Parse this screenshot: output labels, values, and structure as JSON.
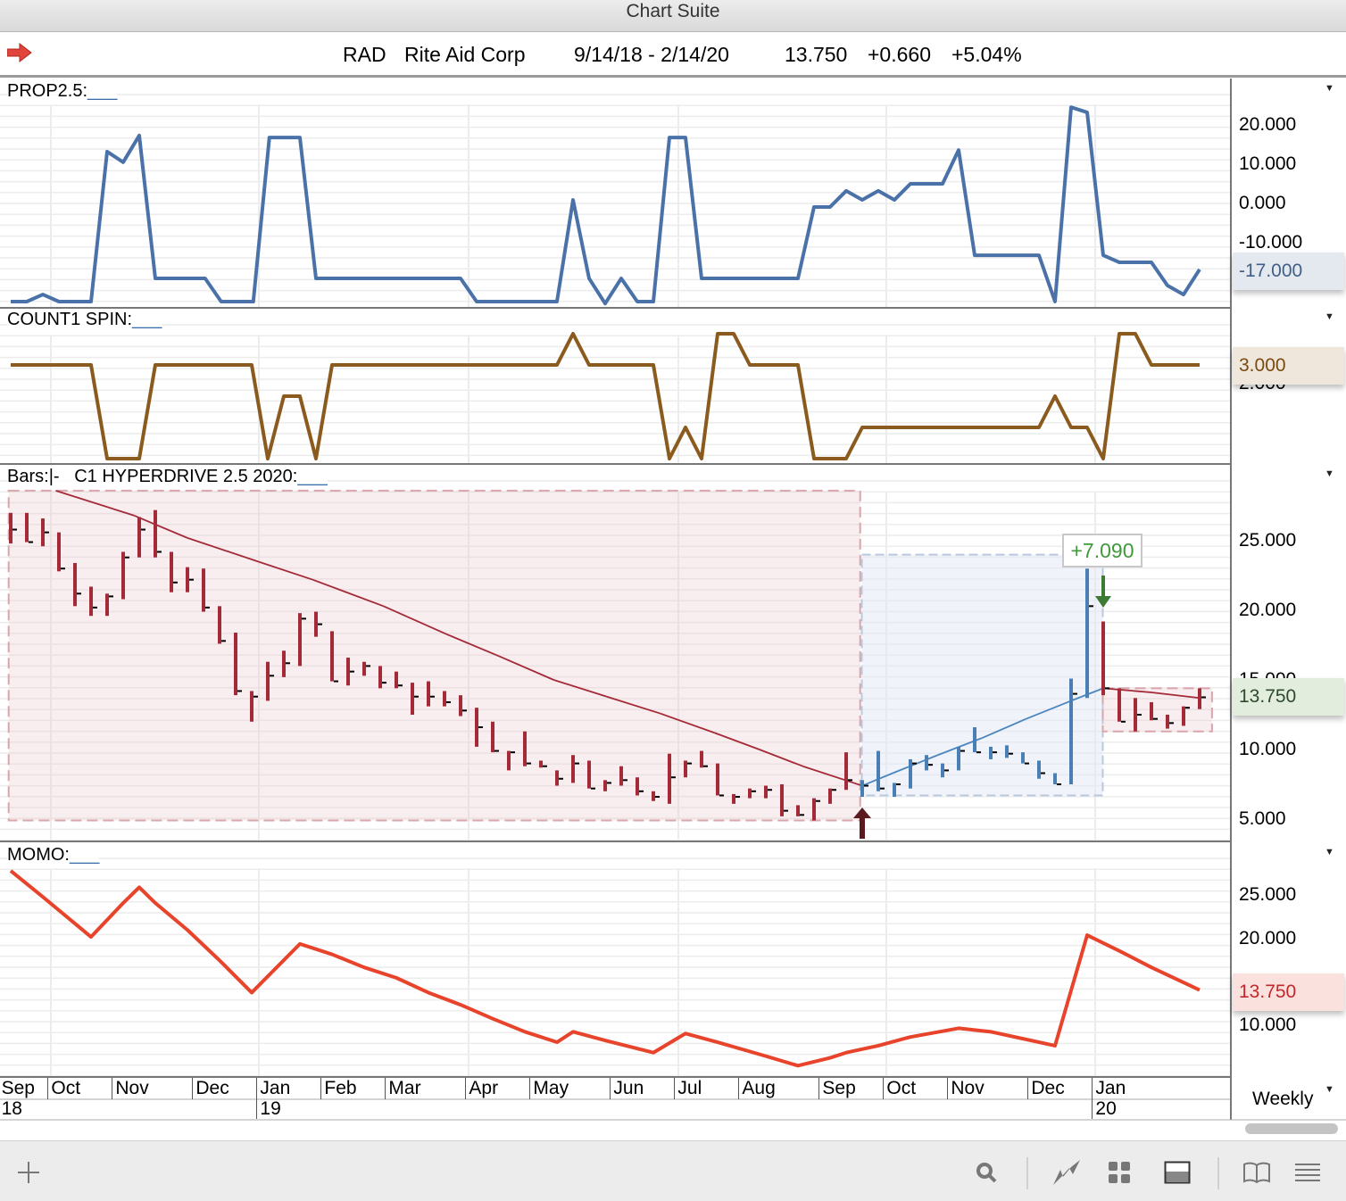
{
  "window": {
    "title": "Chart Suite"
  },
  "symbol_bar": {
    "ticker": "RAD",
    "company": "Rite Aid Corp",
    "date_range": "9/14/18 - 2/14/20",
    "last": "13.750",
    "change": "+0.660",
    "change_pct": "+5.04%",
    "icon": "red-arrow-icon"
  },
  "colors": {
    "prop": "#4a72a8",
    "count": "#8b5a1e",
    "bar_red": "#a52a38",
    "bar_blue": "#4a7fb5",
    "momo": "#e8432b",
    "gain_label": "#3f9a3a"
  },
  "panels": {
    "prop": {
      "label": "PROP2.5:",
      "param": "___",
      "ticks": [
        "20.000",
        "10.000",
        "0.000",
        "-10.000"
      ],
      "current": "-17.000"
    },
    "count": {
      "label": "COUNT1 SPIN:",
      "param": "___",
      "ticks": [
        "2.000"
      ],
      "current": "3.000"
    },
    "bars": {
      "label": "Bars:",
      "bar_style": "|-",
      "study": "C1 HYPERDRIVE 2.5 2020:",
      "param": "___",
      "ticks": [
        "25.000",
        "20.000",
        "15.000",
        "10.000",
        "5.000"
      ],
      "current": "13.750",
      "gain_annotation": "+7.090"
    },
    "momo": {
      "label": "MOMO:",
      "param": "___",
      "ticks": [
        "25.000",
        "20.000",
        "10.000"
      ],
      "current": "13.750"
    }
  },
  "x_axis": {
    "months": [
      [
        "Sep",
        -0.3
      ],
      [
        "Oct",
        2.8
      ],
      [
        "Nov",
        6.8
      ],
      [
        "Dec",
        11.8
      ],
      [
        "Jan",
        15.8
      ],
      [
        "Feb",
        19.8
      ],
      [
        "Mar",
        23.8
      ],
      [
        "Apr",
        28.8
      ],
      [
        "May",
        32.8
      ],
      [
        "Jun",
        37.8
      ],
      [
        "Jul",
        41.8
      ],
      [
        "Aug",
        45.8
      ],
      [
        "Sep",
        50.8
      ],
      [
        "Oct",
        54.8
      ],
      [
        "Nov",
        58.8
      ],
      [
        "Dec",
        63.8
      ],
      [
        "Jan",
        67.8
      ]
    ],
    "years": [
      [
        "18",
        -0.3
      ],
      [
        "19",
        15.8
      ],
      [
        "20",
        67.8
      ]
    ],
    "periodicity": "Weekly"
  },
  "chart_data": [
    {
      "type": "line",
      "name": "PROP2.5",
      "x_unit": "week index from 9/14/18",
      "ylim": [
        -26,
        25
      ],
      "points": [
        [
          0,
          -25
        ],
        [
          1,
          -25
        ],
        [
          2,
          -23.2
        ],
        [
          3,
          -25
        ],
        [
          5,
          -25
        ],
        [
          6,
          13.2
        ],
        [
          7,
          10.5
        ],
        [
          8,
          17.3
        ],
        [
          9,
          -19.1
        ],
        [
          12.1,
          -19.1
        ],
        [
          13.1,
          -25
        ],
        [
          15.1,
          -25
        ],
        [
          16.1,
          16.8
        ],
        [
          18,
          16.8
        ],
        [
          19,
          -19.1
        ],
        [
          28,
          -19.1
        ],
        [
          29,
          -25
        ],
        [
          34,
          -25
        ],
        [
          35,
          0.9
        ],
        [
          36,
          -19.1
        ],
        [
          37,
          -25.5
        ],
        [
          38,
          -19.1
        ],
        [
          39,
          -25
        ],
        [
          40,
          -25
        ],
        [
          41,
          16.8
        ],
        [
          42,
          16.8
        ],
        [
          43,
          -19.1
        ],
        [
          49,
          -19.1
        ],
        [
          50,
          -0.9
        ],
        [
          51,
          -0.9
        ],
        [
          52,
          3.2
        ],
        [
          53,
          0.9
        ],
        [
          54,
          3.2
        ],
        [
          55,
          0.9
        ],
        [
          56,
          5
        ],
        [
          58,
          5
        ],
        [
          59,
          13.6
        ],
        [
          60,
          -13.2
        ],
        [
          64,
          -13.2
        ],
        [
          65,
          -25
        ],
        [
          66,
          24.5
        ],
        [
          67,
          23.2
        ],
        [
          68,
          -13.2
        ],
        [
          69,
          -15
        ],
        [
          71,
          -15
        ],
        [
          72,
          -20.9
        ],
        [
          73,
          -23.2
        ],
        [
          74,
          -16.8
        ]
      ]
    },
    {
      "type": "line",
      "name": "COUNT1 SPIN",
      "ylim": [
        0,
        4
      ],
      "points": [
        [
          0,
          3
        ],
        [
          5,
          3
        ],
        [
          6,
          0
        ],
        [
          8,
          0
        ],
        [
          9,
          3
        ],
        [
          15,
          3
        ],
        [
          16,
          0
        ],
        [
          17,
          2
        ],
        [
          18,
          2
        ],
        [
          19,
          0
        ],
        [
          20,
          3
        ],
        [
          34,
          3
        ],
        [
          35,
          4
        ],
        [
          36,
          3
        ],
        [
          40,
          3
        ],
        [
          41,
          0
        ],
        [
          42,
          1
        ],
        [
          43,
          0
        ],
        [
          44,
          4
        ],
        [
          45,
          4
        ],
        [
          46,
          3
        ],
        [
          49,
          3
        ],
        [
          50,
          0
        ],
        [
          52,
          0
        ],
        [
          53,
          1
        ],
        [
          64,
          1
        ],
        [
          65,
          2
        ],
        [
          66,
          1
        ],
        [
          67,
          1
        ],
        [
          68,
          0
        ],
        [
          69,
          4
        ],
        [
          70,
          4
        ],
        [
          71,
          3
        ],
        [
          74,
          3
        ]
      ]
    },
    {
      "type": "bar-hlc",
      "name": "RAD weekly bars",
      "ylim": [
        4.5,
        29
      ],
      "hlc": [
        [
          27.0,
          24.8,
          25.8
        ],
        [
          27.0,
          24.9,
          24.9
        ],
        [
          26.6,
          24.6,
          25.6
        ],
        [
          25.6,
          22.8,
          23.0
        ],
        [
          23.4,
          20.3,
          21.2
        ],
        [
          21.7,
          19.6,
          20.2
        ],
        [
          21.2,
          19.6,
          21.0
        ],
        [
          24.2,
          20.8,
          23.8
        ],
        [
          26.7,
          23.8,
          25.8
        ],
        [
          27.2,
          23.8,
          24.2
        ],
        [
          24.2,
          21.3,
          22.0
        ],
        [
          23.1,
          21.3,
          22.2
        ],
        [
          23.0,
          19.9,
          20.2
        ],
        [
          20.3,
          17.6,
          17.8
        ],
        [
          18.4,
          13.9,
          14.2
        ],
        [
          14.2,
          12.0,
          13.8
        ],
        [
          16.3,
          13.5,
          15.3
        ],
        [
          17.1,
          15.2,
          16.2
        ],
        [
          19.8,
          16.0,
          19.4
        ],
        [
          19.9,
          18.1,
          19.0
        ],
        [
          18.5,
          14.9,
          14.9
        ],
        [
          16.6,
          14.6,
          15.6
        ],
        [
          16.3,
          15.3,
          16.0
        ],
        [
          16.0,
          14.4,
          14.8
        ],
        [
          15.6,
          14.4,
          14.6
        ],
        [
          14.8,
          12.5,
          13.8
        ],
        [
          14.9,
          13.1,
          13.8
        ],
        [
          14.2,
          13.1,
          13.4
        ],
        [
          13.9,
          12.4,
          12.8
        ],
        [
          13.0,
          10.2,
          11.6
        ],
        [
          12.0,
          9.8,
          9.9
        ],
        [
          9.9,
          8.5,
          9.8
        ],
        [
          11.3,
          8.8,
          9.0
        ],
        [
          9.2,
          8.7,
          8.8
        ],
        [
          8.5,
          7.4,
          7.9
        ],
        [
          9.6,
          7.6,
          9.0
        ],
        [
          9.2,
          7.2,
          7.2
        ],
        [
          7.8,
          7.0,
          7.6
        ],
        [
          8.8,
          7.4,
          7.8
        ],
        [
          8.0,
          6.7,
          7.0
        ],
        [
          7.0,
          6.3,
          6.6
        ],
        [
          9.7,
          6.1,
          8.0
        ],
        [
          9.2,
          8.0,
          9.0
        ],
        [
          9.9,
          8.7,
          8.8
        ],
        [
          9.0,
          6.7,
          6.7
        ],
        [
          6.8,
          6.1,
          6.6
        ],
        [
          7.2,
          6.5,
          7.0
        ],
        [
          7.4,
          6.5,
          7.1
        ],
        [
          7.5,
          5.2,
          5.6
        ],
        [
          6.0,
          5.2,
          5.3
        ],
        [
          6.5,
          4.9,
          6.3
        ],
        [
          7.2,
          6.1,
          7.1
        ],
        [
          9.8,
          7.1,
          7.8
        ],
        [
          7.8,
          6.6,
          7.4
        ],
        [
          9.9,
          7.0,
          7.2
        ],
        [
          7.6,
          6.6,
          7.5
        ],
        [
          9.3,
          7.2,
          9.0
        ],
        [
          9.6,
          8.5,
          8.9
        ],
        [
          9.0,
          8.0,
          8.5
        ],
        [
          10.2,
          8.5,
          9.9
        ],
        [
          11.6,
          9.8,
          9.8
        ],
        [
          10.2,
          9.3,
          9.8
        ],
        [
          10.3,
          9.4,
          9.7
        ],
        [
          9.8,
          9.0,
          9.0
        ],
        [
          9.2,
          7.9,
          8.3
        ],
        [
          8.3,
          7.5,
          7.5
        ],
        [
          15.1,
          7.5,
          14.0
        ],
        [
          23.0,
          13.7,
          20.3
        ],
        [
          19.2,
          13.9,
          14.4
        ],
        [
          14.4,
          12.0,
          12.0
        ],
        [
          13.7,
          11.3,
          12.5
        ],
        [
          13.4,
          12.1,
          12.2
        ],
        [
          12.5,
          11.5,
          11.9
        ],
        [
          13.1,
          11.7,
          13.0
        ],
        [
          14.4,
          12.9,
          13.75
        ]
      ],
      "long_range": [
        53,
        67
      ],
      "moving_average": [
        [
          2.8,
          28.6
        ],
        [
          7.7,
          26.8
        ],
        [
          11,
          25.2
        ],
        [
          15.4,
          23.5
        ],
        [
          18.8,
          22.2
        ],
        [
          23.2,
          20.3
        ],
        [
          27.1,
          18.3
        ],
        [
          30.4,
          16.7
        ],
        [
          33.8,
          15.0
        ],
        [
          37.1,
          13.8
        ],
        [
          40.4,
          12.6
        ],
        [
          43.8,
          11.2
        ],
        [
          46.6,
          10.0
        ],
        [
          49.3,
          8.8
        ],
        [
          53,
          7.4
        ],
        [
          54.9,
          8.3
        ],
        [
          57.7,
          9.6
        ],
        [
          60.4,
          10.8
        ],
        [
          63.2,
          12.2
        ],
        [
          66,
          13.5
        ],
        [
          68,
          14.4
        ],
        [
          71,
          14.1
        ],
        [
          74,
          13.7
        ]
      ],
      "zones": [
        {
          "kind": "short",
          "from": -0.1,
          "to": 52.9,
          "low": 4.9,
          "high": 28.6
        },
        {
          "kind": "long",
          "from": 53,
          "to": 68,
          "low": 6.7,
          "high": 24.0
        },
        {
          "kind": "short",
          "from": 68,
          "to": 74.8,
          "low": 11.3,
          "high": 14.4
        }
      ],
      "entry_arrow_week": 53,
      "exit_arrow_week": 68
    },
    {
      "type": "line",
      "name": "MOMO",
      "ylim": [
        4,
        29
      ],
      "points": [
        [
          0,
          27.8
        ],
        [
          2,
          24.8
        ],
        [
          5,
          20.2
        ],
        [
          7,
          24.1
        ],
        [
          8,
          25.9
        ],
        [
          9,
          24.1
        ],
        [
          11,
          21.0
        ],
        [
          13,
          17.5
        ],
        [
          15,
          13.8
        ],
        [
          18,
          19.4
        ],
        [
          20,
          18.2
        ],
        [
          22,
          16.7
        ],
        [
          24,
          15.5
        ],
        [
          26,
          13.8
        ],
        [
          28,
          12.4
        ],
        [
          30,
          10.8
        ],
        [
          32,
          9.3
        ],
        [
          34,
          8.1
        ],
        [
          35,
          9.3
        ],
        [
          37,
          8.3
        ],
        [
          40,
          6.9
        ],
        [
          42,
          9.1
        ],
        [
          44,
          8.1
        ],
        [
          47,
          6.5
        ],
        [
          49,
          5.4
        ],
        [
          51,
          6.3
        ],
        [
          52,
          6.9
        ],
        [
          54,
          7.7
        ],
        [
          56,
          8.7
        ],
        [
          59,
          9.7
        ],
        [
          61,
          9.3
        ],
        [
          65,
          7.7
        ],
        [
          67,
          20.4
        ],
        [
          69,
          18.6
        ],
        [
          71,
          16.7
        ],
        [
          74,
          14.1
        ]
      ]
    }
  ]
}
